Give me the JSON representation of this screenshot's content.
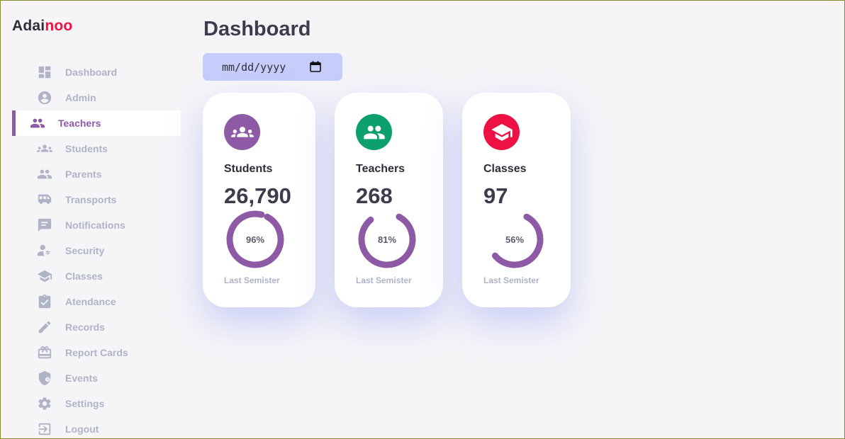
{
  "brand": {
    "part1": "Adai",
    "part2": "noo"
  },
  "sidebar": {
    "items": [
      {
        "label": "Dashboard",
        "icon": "dashboard-icon"
      },
      {
        "label": "Admin",
        "icon": "account-circle-icon"
      },
      {
        "label": "Teachers",
        "icon": "people-icon",
        "active": true
      },
      {
        "label": "Students",
        "icon": "groups-icon"
      },
      {
        "label": "Parents",
        "icon": "people-icon"
      },
      {
        "label": "Transports",
        "icon": "bus-icon"
      },
      {
        "label": "Notifications",
        "icon": "feedback-icon"
      },
      {
        "label": "Security",
        "icon": "manage-accounts-icon"
      },
      {
        "label": "Classes",
        "icon": "school-icon"
      },
      {
        "label": "Atendance",
        "icon": "clipboard-check-icon"
      },
      {
        "label": "Records",
        "icon": "pencil-icon"
      },
      {
        "label": "Report Cards",
        "icon": "card-giftcard-icon"
      },
      {
        "label": "Events",
        "icon": "shield-icon"
      },
      {
        "label": "Settings",
        "icon": "gear-icon"
      },
      {
        "label": "Logout",
        "icon": "logout-icon"
      }
    ]
  },
  "main": {
    "title": "Dashboard",
    "date_input": {
      "placeholder": "mm/dd/yyyy"
    },
    "cards": [
      {
        "label": "Students",
        "value": "26,790",
        "percent": 96,
        "percent_label": "96%",
        "subtitle": "Last Semister",
        "color": "#8e5aa5",
        "icon": "groups-icon"
      },
      {
        "label": "Teachers",
        "value": "268",
        "percent": 81,
        "percent_label": "81%",
        "subtitle": "Last Semister",
        "color": "#0e9f6e",
        "icon": "people-icon"
      },
      {
        "label": "Classes",
        "value": "97",
        "percent": 56,
        "percent_label": "56%",
        "subtitle": "Last Semister",
        "color": "#ee1144",
        "icon": "school-icon"
      }
    ]
  },
  "colors": {
    "accent": "#8e5aa5",
    "ring": "#8e5aa5",
    "brand_accent": "#ee1144",
    "date_bg": "#c6cdfb"
  }
}
